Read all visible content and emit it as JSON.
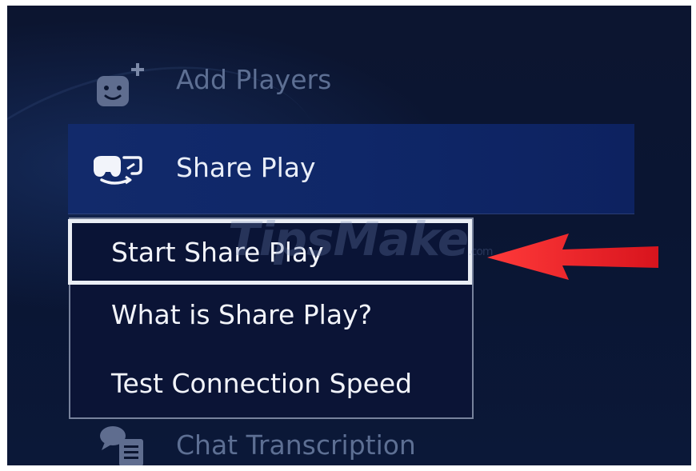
{
  "menu": {
    "add_players": {
      "label": "Add Players",
      "icon": "face-plus-icon"
    },
    "share_play": {
      "label": "Share Play",
      "icon": "share-play-controller-icon"
    },
    "chat_transcription": {
      "label": "Chat Transcription",
      "icon": "chat-bubbles-icon"
    }
  },
  "submenu": {
    "items": [
      {
        "label": "Start Share Play"
      },
      {
        "label": "What is Share Play?"
      },
      {
        "label": "Test Connection Speed"
      }
    ]
  },
  "watermark": {
    "text": "TipsMake",
    "suffix": ".com"
  },
  "colors": {
    "background": "#0a1532",
    "highlight": "#0f2768",
    "focus_border": "#eaeef5",
    "dim_text": "#5d6f93",
    "arrow": "#e8202a"
  }
}
